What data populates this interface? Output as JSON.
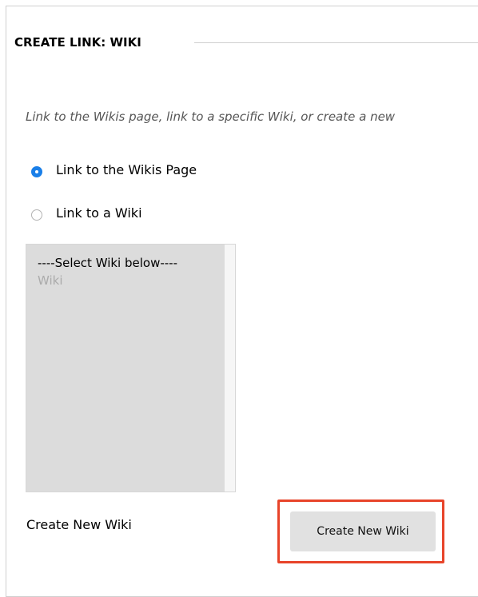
{
  "section": {
    "title": "CREATE LINK: WIKI",
    "instructions": "Link to the Wikis page, link to a specific Wiki, or create a new"
  },
  "options": {
    "link_wikis_page": {
      "label": "Link to the Wikis Page",
      "checked": true
    },
    "link_to_wiki": {
      "label": "Link to a Wiki",
      "checked": false
    }
  },
  "wiki_list": {
    "items": [
      "----Select Wiki below----",
      "Wiki"
    ]
  },
  "create": {
    "label": "Create New Wiki",
    "button_label": "Create New Wiki"
  },
  "colors": {
    "accent": "#1a7fe8",
    "highlight": "#e8442a",
    "listbox_bg": "#dcdcdc",
    "button_bg": "#e1e1e1"
  }
}
